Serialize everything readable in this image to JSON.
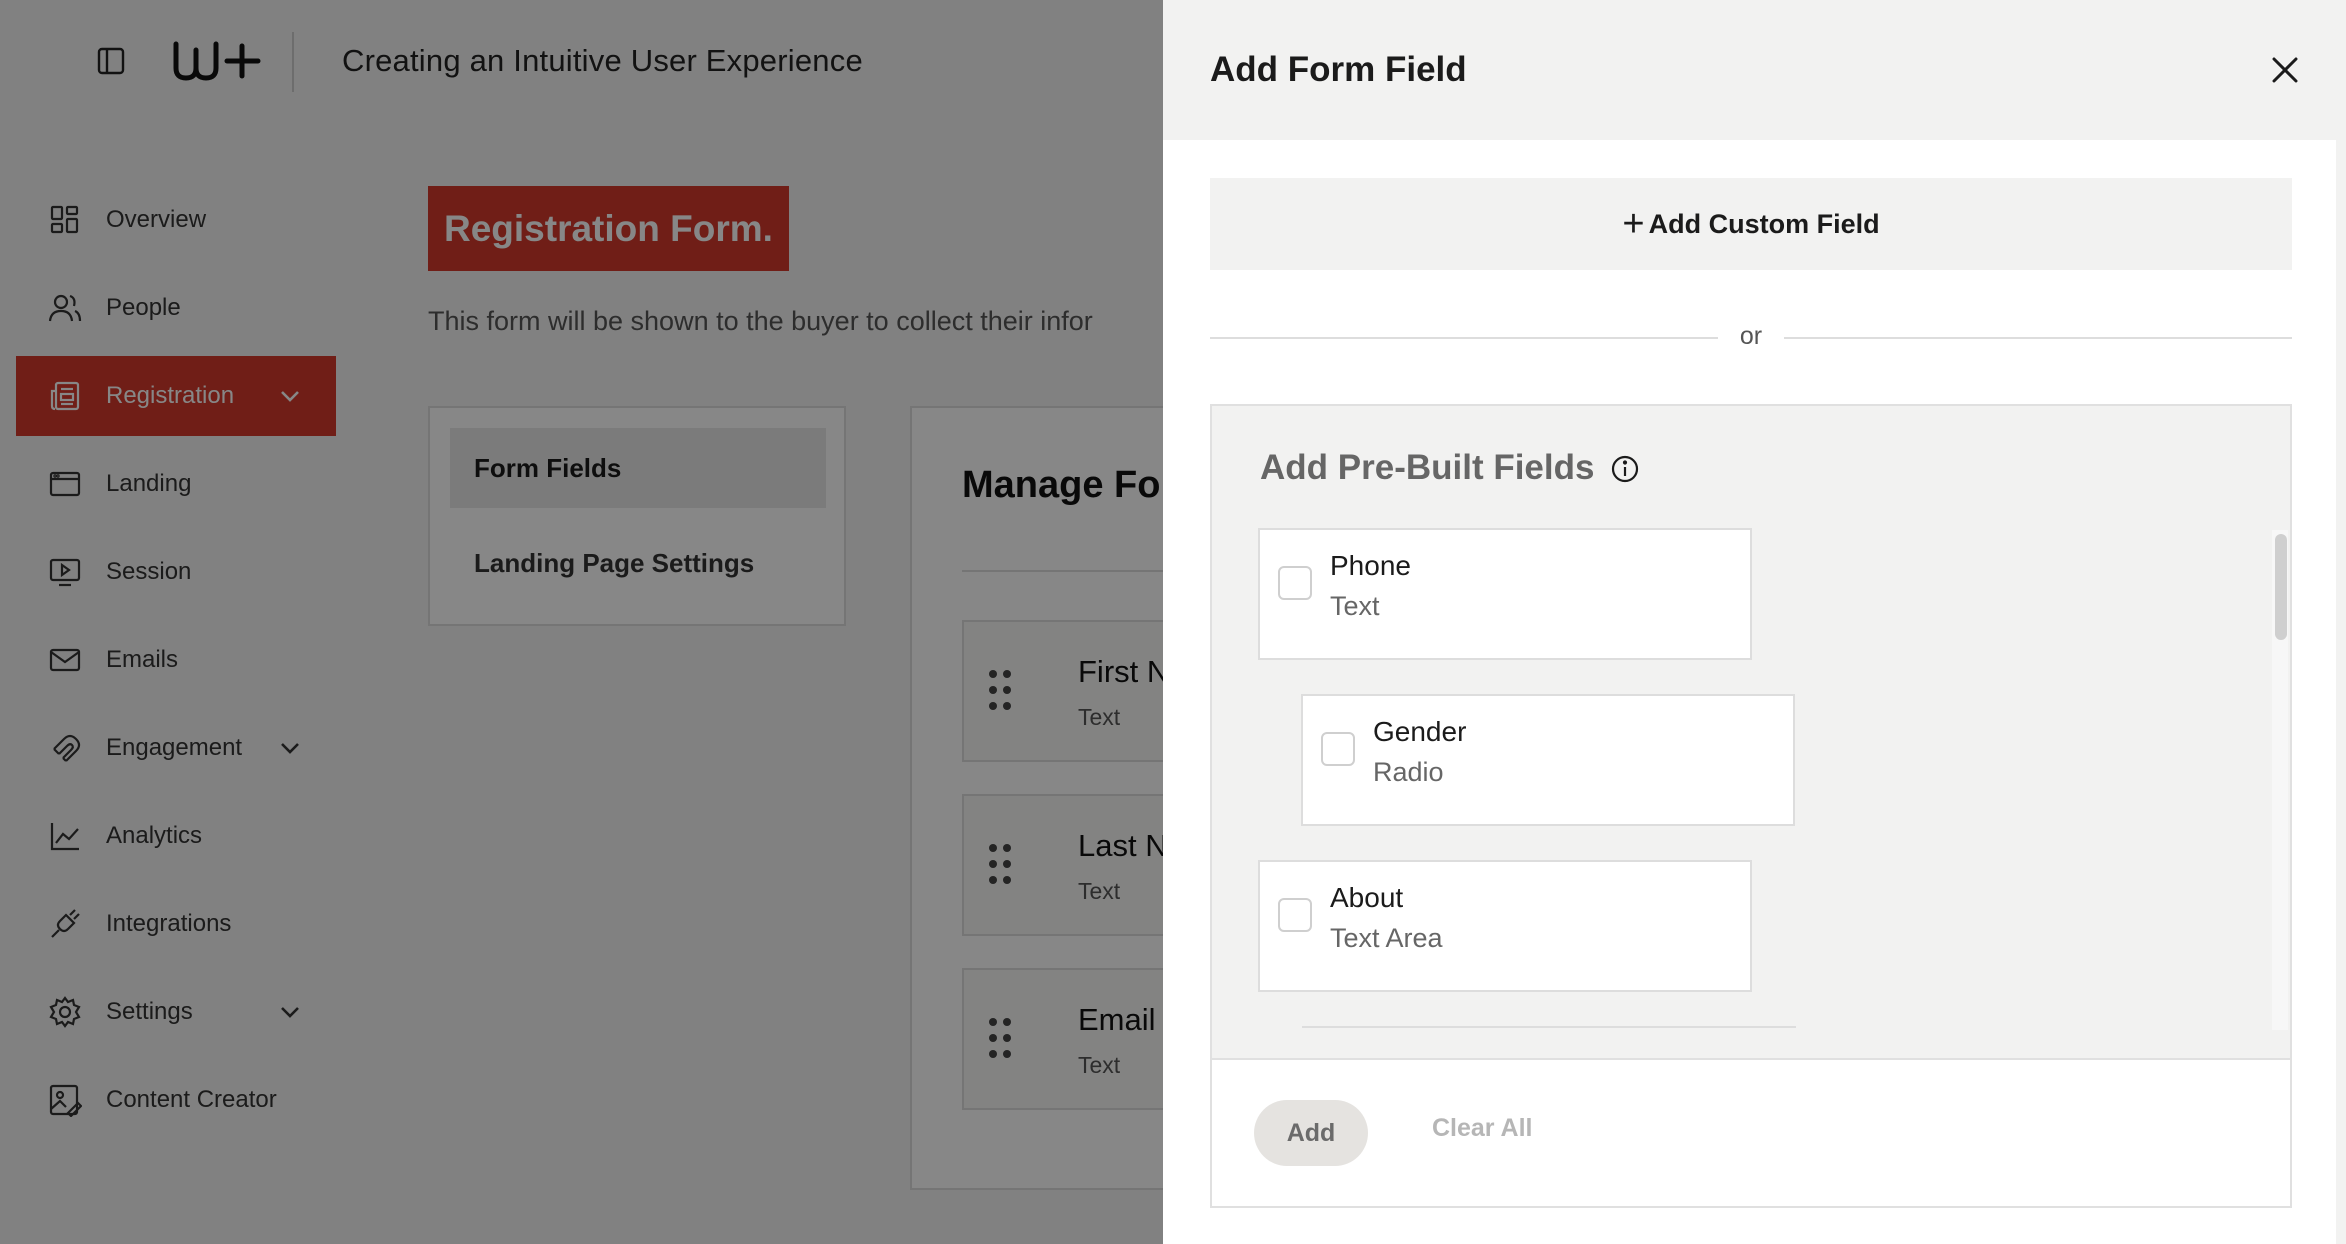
{
  "topbar": {
    "title": "Creating an Intuitive User Experience"
  },
  "sidebar": {
    "items": [
      {
        "label": "Overview",
        "icon": "grid-icon"
      },
      {
        "label": "People",
        "icon": "people-icon"
      },
      {
        "label": "Registration",
        "icon": "newspaper-icon",
        "active": true,
        "expandable": true
      },
      {
        "label": "Landing",
        "icon": "browser-icon"
      },
      {
        "label": "Session",
        "icon": "play-screen-icon"
      },
      {
        "label": "Emails",
        "icon": "mail-icon"
      },
      {
        "label": "Engagement",
        "icon": "magnet-icon",
        "expandable": true
      },
      {
        "label": "Analytics",
        "icon": "line-chart-icon"
      },
      {
        "label": "Integrations",
        "icon": "plug-icon"
      },
      {
        "label": "Settings",
        "icon": "gear-icon",
        "expandable": true
      },
      {
        "label": "Content Creator",
        "icon": "image-edit-icon"
      }
    ]
  },
  "main": {
    "badge": "Registration Form.",
    "description": "This form will be shown to the buyer to collect their infor",
    "tabs": {
      "form_fields": "Form Fields",
      "landing_settings": "Landing Page Settings"
    },
    "manage_title": "Manage Fo",
    "fields": [
      {
        "name": "First N",
        "type": "Text"
      },
      {
        "name": "Last N",
        "type": "Text"
      },
      {
        "name": "Email",
        "type": "Text"
      }
    ]
  },
  "panel": {
    "title": "Add Form Field",
    "add_custom_label": "Add Custom Field",
    "or_text": "or",
    "prebuilt_title": "Add Pre-Built Fields",
    "prebuilt_fields": [
      {
        "name": "Phone",
        "type": "Text"
      },
      {
        "name": "Gender",
        "type": "Radio"
      },
      {
        "name": "About",
        "type": "Text Area"
      }
    ],
    "add_label": "Add",
    "clear_label": "Clear All"
  },
  "colors": {
    "accent": "#d43a2c",
    "overlay": "rgba(0,0,0,0.47)"
  }
}
